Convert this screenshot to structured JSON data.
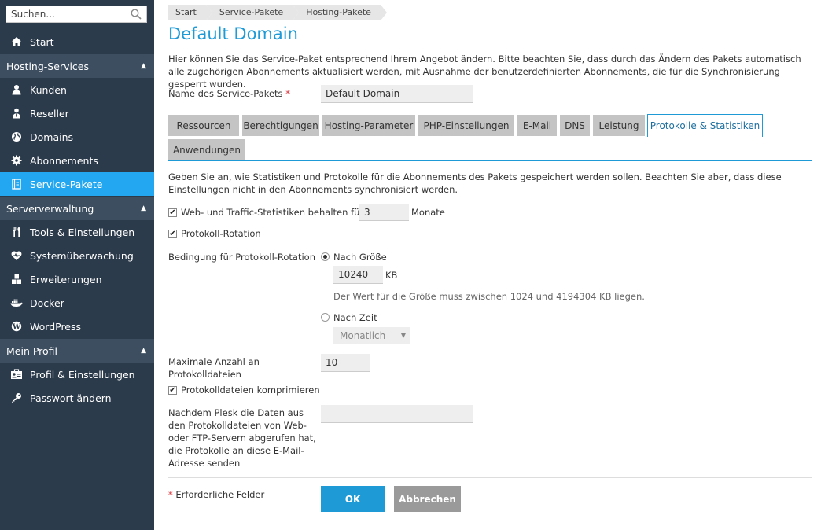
{
  "sidebar": {
    "search": {
      "placeholder": "Suchen..."
    },
    "start": "Start",
    "sections": [
      {
        "title": "Hosting-Services",
        "items": [
          "Kunden",
          "Reseller",
          "Domains",
          "Abonnements",
          "Service-Pakete"
        ]
      },
      {
        "title": "Serververwaltung",
        "items": [
          "Tools & Einstellungen",
          "Systemüberwachung",
          "Erweiterungen",
          "Docker",
          "WordPress"
        ]
      },
      {
        "title": "Mein Profil",
        "items": [
          "Profil & Einstellungen",
          "Passwort ändern"
        ]
      }
    ],
    "active_item": "Service-Pakete"
  },
  "breadcrumb": [
    "Start",
    "Service-Pakete",
    "Hosting-Pakete"
  ],
  "title": "Default Domain",
  "intro": "Hier können Sie das Service-Paket entsprechend Ihrem Angebot ändern. Bitte beachten Sie, dass durch das Ändern des Pakets automatisch alle zugehörigen Abonnements aktualisiert werden, mit Ausnahme der benutzerdefinierten Abonnements, die für die Synchronisierung gesperrt wurden.",
  "package_name": {
    "label": "Name des Service-Pakets",
    "required_mark": "*",
    "value": "Default Domain"
  },
  "tabs": [
    "Ressourcen",
    "Berechtigungen",
    "Hosting-Parameter",
    "PHP-Einstellungen",
    "E-Mail",
    "DNS",
    "Leistung",
    "Protokolle & Statistiken",
    "Anwendungen"
  ],
  "active_tab": "Protokolle & Statistiken",
  "form": {
    "description": "Geben Sie an, wie Statistiken und Protokolle für die Abonnements des Pakets gespeichert werden sollen. Beachten Sie aber, dass diese Einstellungen nicht in den Abonnements synchronisiert werden.",
    "keep_stats": {
      "label": "Web- und Traffic-Statistiken behalten für",
      "value": "3",
      "unit": "Monate",
      "checked": true
    },
    "log_rotation": {
      "label": "Protokoll-Rotation",
      "checked": true
    },
    "rotation_condition": {
      "label": "Bedingung für Protokoll-Rotation",
      "by_size": {
        "label": "Nach Größe",
        "value": "10240",
        "unit": "KB",
        "hint": "Der Wert für die Größe muss zwischen 1024 und 4194304 KB liegen.",
        "selected": true
      },
      "by_time": {
        "label": "Nach Zeit",
        "selected": false,
        "select_value": "Monatlich"
      }
    },
    "max_logs": {
      "label_line1": "Maximale Anzahl an",
      "label_line2": "Protokolldateien",
      "value": "10"
    },
    "compress": {
      "label": "Protokolldateien komprimieren",
      "checked": true
    },
    "email": {
      "label_lines": [
        "Nachdem Plesk die Daten aus",
        "den Protokolldateien von Web-",
        "oder FTP-Servern abgerufen hat,",
        "die Protokolle an diese E-Mail-",
        "Adresse senden"
      ],
      "value": ""
    }
  },
  "footer": {
    "required_mark": "*",
    "required_text": "Erforderliche Felder",
    "ok": "OK",
    "cancel": "Abbrechen"
  }
}
